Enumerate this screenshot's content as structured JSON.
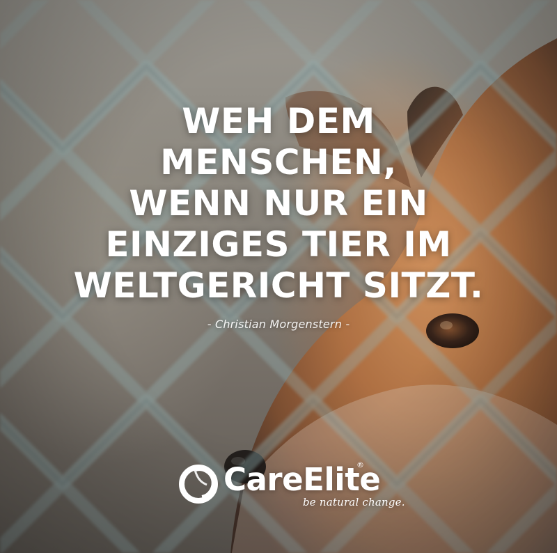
{
  "quote": {
    "lines": [
      "WEH DEM",
      "MENSCHEN,",
      "WENN NUR EIN",
      "EINZIGES TIER IM",
      "WELTGERICHT SITZT."
    ]
  },
  "author": "- Christian Morgenstern -",
  "brand": {
    "name": "CareElite",
    "registered": "®",
    "tagline": "be natural change."
  },
  "colors": {
    "text": "#ffffff",
    "fox_fur": "#b97745",
    "fence": "#95b3b5",
    "background": "#7f7a72"
  },
  "image": {
    "subject_icons": [
      "fox-photo",
      "chain-link-fence"
    ]
  }
}
